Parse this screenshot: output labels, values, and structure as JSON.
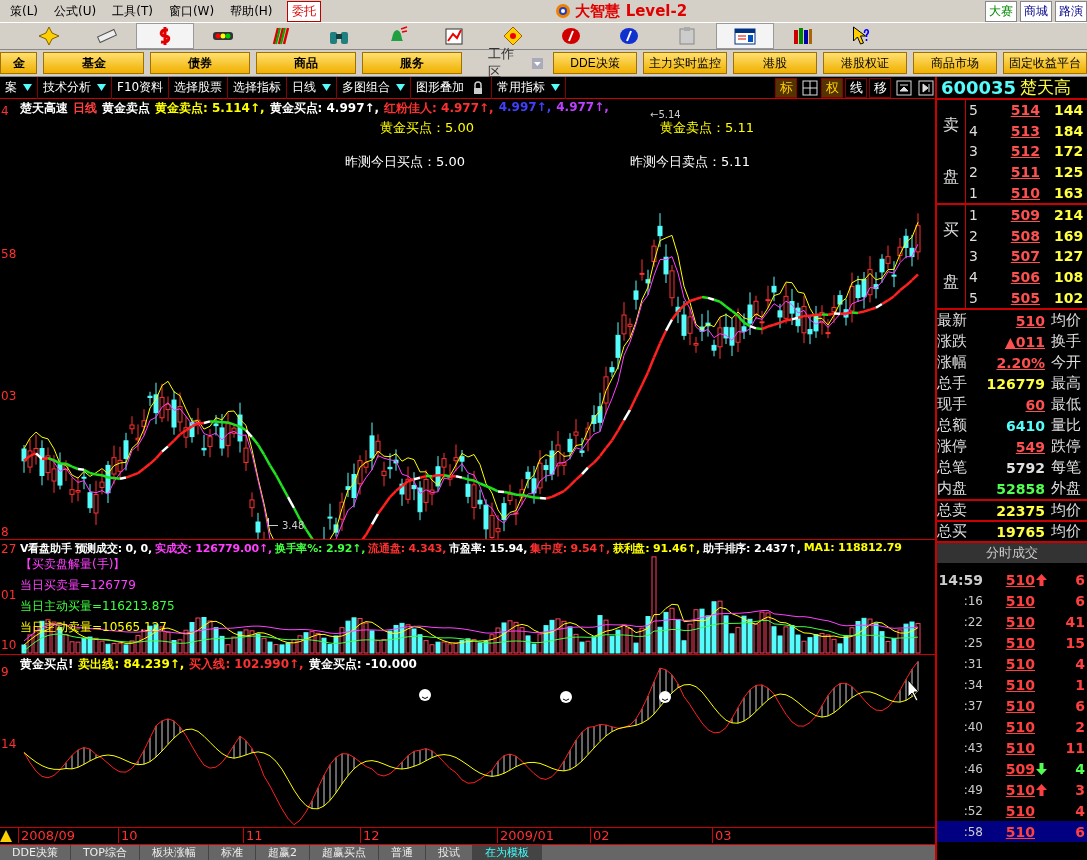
{
  "menu": {
    "items": [
      "策(L)",
      "公式(U)",
      "工具(T)",
      "窗口(W)",
      "帮助(H)"
    ],
    "trade_button": "委托",
    "app_title": "大智慧 Level-2",
    "right_links": [
      "大赛",
      "商城",
      "路演"
    ]
  },
  "toolbar": [
    {
      "kind": "cross",
      "selected": false
    },
    {
      "kind": "ruler",
      "selected": false
    },
    {
      "kind": "dollar",
      "selected": true
    },
    {
      "kind": "lights",
      "selected": false
    },
    {
      "kind": "bars",
      "selected": false
    },
    {
      "kind": "binoculars",
      "selected": false
    },
    {
      "kind": "bell",
      "selected": false
    },
    {
      "kind": "chart",
      "selected": false
    },
    {
      "kind": "diamond",
      "selected": false
    },
    {
      "kind": "redcoin",
      "selected": false
    },
    {
      "kind": "bluecoin",
      "selected": false
    },
    {
      "kind": "clipboard",
      "selected": false
    },
    {
      "kind": "window",
      "selected": true
    },
    {
      "kind": "books",
      "selected": false
    },
    {
      "kind": "help",
      "selected": false
    }
  ],
  "quick_bar": {
    "left_buttons": [
      "金",
      "基金",
      "债券",
      "商品",
      "服务"
    ],
    "workspace_label": "工作区",
    "right_buttons": [
      "DDE决策",
      "主力实时监控",
      "港股",
      "港股权证",
      "商品市场",
      "固定收益平台"
    ]
  },
  "tabs": [
    {
      "label": "案",
      "dropdown": true
    },
    {
      "label": "技术分析",
      "dropdown": true
    },
    {
      "label": "F10资料",
      "dropdown": false
    },
    {
      "label": "选择股票",
      "dropdown": false
    },
    {
      "label": "选择指标",
      "dropdown": false
    },
    {
      "label": "日线",
      "dropdown": true
    },
    {
      "label": "多图组合",
      "dropdown": true
    },
    {
      "label": "图形叠加",
      "dropdown": false,
      "lock": true
    },
    {
      "label": "常用指标",
      "dropdown": true
    }
  ],
  "view_buttons": [
    {
      "kind": "text",
      "label": "标",
      "selected": true
    },
    {
      "kind": "grid"
    },
    {
      "kind": "text",
      "label": "权",
      "selected": true
    },
    {
      "kind": "text",
      "label": "线",
      "selected": false
    },
    {
      "kind": "text",
      "label": "移",
      "selected": false
    },
    {
      "kind": "up"
    },
    {
      "kind": "end"
    }
  ],
  "stock": {
    "code": "600035",
    "name": "楚天高"
  },
  "order_book": {
    "sell_labels": [
      "卖",
      "盘"
    ],
    "buy_labels": [
      "买",
      "盘"
    ],
    "sell": [
      {
        "rank": "5",
        "price": "514",
        "volume": "144"
      },
      {
        "rank": "4",
        "price": "513",
        "volume": "184"
      },
      {
        "rank": "3",
        "price": "512",
        "volume": "172"
      },
      {
        "rank": "2",
        "price": "511",
        "volume": "125"
      },
      {
        "rank": "1",
        "price": "510",
        "volume": "163"
      }
    ],
    "buy": [
      {
        "rank": "1",
        "price": "509",
        "volume": "214"
      },
      {
        "rank": "2",
        "price": "508",
        "volume": "169"
      },
      {
        "rank": "3",
        "price": "507",
        "volume": "127"
      },
      {
        "rank": "4",
        "price": "506",
        "volume": "108"
      },
      {
        "rank": "5",
        "price": "505",
        "volume": "102"
      }
    ]
  },
  "stats": [
    {
      "label": "最新",
      "value": "510",
      "label2": "均价",
      "color": "#ff5050"
    },
    {
      "label": "涨跌",
      "value": "▲011",
      "label2": "换手",
      "color": "#ff5050"
    },
    {
      "label": "涨幅",
      "value": "2.20%",
      "label2": "今开",
      "color": "#ff5050"
    },
    {
      "label": "总手",
      "value": "126779",
      "label2": "最高",
      "color": "#ffff40"
    },
    {
      "label": "现手",
      "value": "60",
      "label2": "最低",
      "color": "#ff5050"
    },
    {
      "label": "总额",
      "value": "6410",
      "label2": "量比",
      "color": "#54fcfc"
    },
    {
      "label": "涨停",
      "value": "549",
      "label2": "跌停",
      "color": "#ff5050"
    },
    {
      "label": "总笔",
      "value": "5792",
      "label2": "每笔",
      "color": "#e0e0e0"
    },
    {
      "label": "内盘",
      "value": "52858",
      "label2": "外盘",
      "color": "#50ff50"
    }
  ],
  "totals": [
    {
      "label": "总卖",
      "value": "22375",
      "label2": "均价"
    },
    {
      "label": "总买",
      "value": "19765",
      "label2": "均价"
    }
  ],
  "trades": {
    "title": "分时成交",
    "rows": [
      {
        "kind": "up",
        "time": "14:59",
        "price": "510",
        "volume": "6",
        "selected": false
      },
      {
        "kind": "plain",
        "time": ":16",
        "price": "510",
        "volume": "6",
        "selected": false
      },
      {
        "kind": "plain",
        "time": ":22",
        "price": "510",
        "volume": "41",
        "selected": false
      },
      {
        "kind": "plain",
        "time": ":25",
        "price": "510",
        "volume": "15",
        "selected": false
      },
      {
        "kind": "plain",
        "time": ":31",
        "price": "510",
        "volume": "4",
        "selected": false
      },
      {
        "kind": "plain",
        "time": ":34",
        "price": "510",
        "volume": "1",
        "selected": false
      },
      {
        "kind": "plain",
        "time": ":37",
        "price": "510",
        "volume": "6",
        "selected": false
      },
      {
        "kind": "plain",
        "time": ":40",
        "price": "510",
        "volume": "2",
        "selected": false
      },
      {
        "kind": "plain",
        "time": ":43",
        "price": "510",
        "volume": "11",
        "selected": false
      },
      {
        "kind": "down",
        "time": ":46",
        "price": "509",
        "volume": "4",
        "selected": false
      },
      {
        "kind": "up",
        "time": ":49",
        "price": "510",
        "volume": "3",
        "selected": false
      },
      {
        "kind": "plain",
        "time": ":52",
        "price": "510",
        "volume": "4",
        "selected": false
      },
      {
        "kind": "plain",
        "time": ":58",
        "price": "510",
        "volume": "6",
        "selected": true
      }
    ]
  },
  "main_chart": {
    "legend": [
      {
        "text": "楚天高速",
        "color": "#ffffff"
      },
      {
        "text": "日线",
        "color": "#ff4040"
      },
      {
        "text": "黄金卖点",
        "color": "#ffffff"
      },
      {
        "text": "黄金卖点: 5.114↑,",
        "color": "#ffff00"
      },
      {
        "text": "黄金买点: 4.997↑,",
        "color": "#ffffff"
      },
      {
        "text": "红粉佳人: 4.977↑,",
        "color": "#ff3030"
      },
      {
        "text": "4.997↑,",
        "color": "#4040ff"
      },
      {
        "text": "4.977↑,",
        "color": "#c040ff"
      }
    ],
    "axis_labels": [
      "4",
      "58",
      "03",
      "8"
    ],
    "annotations": [
      {
        "text": "黄金买点：5.00",
        "color": "#ffff00"
      },
      {
        "text": "黄金卖点：5.11",
        "color": "#ffff00"
      },
      {
        "text": "昨测今日买点：5.00",
        "color": "#ffffff"
      },
      {
        "text": "昨测今日卖点：5.11",
        "color": "#ffffff"
      }
    ],
    "high_mark": "←5.14",
    "low_mark": "3.48"
  },
  "volume_panel": {
    "legend": [
      {
        "text": "V看盘助手",
        "color": "#ffffff"
      },
      {
        "text": "预测成交: 0, 0,",
        "color": "#ffffff"
      },
      {
        "text": "实成交: 126779.00↑,",
        "color": "#ff40ff"
      },
      {
        "text": "换手率%: 2.92↑,",
        "color": "#40ff40"
      },
      {
        "text": "流通盘: 4.343,",
        "color": "#ff3030"
      },
      {
        "text": "市盈率: 15.94,",
        "color": "#ffffff"
      },
      {
        "text": "集中度: 9.54↑,",
        "color": "#ff3030"
      },
      {
        "text": "获利盘: 91.46↑,",
        "color": "#ffff00"
      },
      {
        "text": "助手排序: 2.437↑,",
        "color": "#ffffff"
      },
      {
        "text": "MA1: 118812.79",
        "color": "#ffff00"
      }
    ],
    "notes": [
      {
        "text": "【买卖盘解量(手)】",
        "color": "#ff40ff"
      },
      {
        "text": "当日买卖量=126779",
        "color": "#ff40ff"
      },
      {
        "text": "当日主动买量=116213.875",
        "color": "#40ff40"
      },
      {
        "text": "当日主动卖量=10565.127",
        "color": "#ffff00"
      }
    ],
    "axis_labels": [
      "27",
      "01",
      "10"
    ]
  },
  "signal_panel": {
    "legend": [
      {
        "text": "黄金买点!",
        "color": "#ffffff"
      },
      {
        "text": "卖出线: 84.239↑,",
        "color": "#ffff00"
      },
      {
        "text": "买入线: 102.990↑,",
        "color": "#ff3030"
      },
      {
        "text": "黄金买点: -10.000",
        "color": "#ffffff"
      }
    ],
    "axis_labels": [
      "9",
      "14"
    ]
  },
  "date_axis": [
    "2008/09",
    "10",
    "11",
    "12",
    "2009/01",
    "02",
    "03"
  ],
  "bottom_tabs": [
    {
      "label": "DDE决策",
      "selected": false
    },
    {
      "label": "TOP综合",
      "selected": false
    },
    {
      "label": "板块涨幅",
      "selected": false
    },
    {
      "label": "标准",
      "selected": false
    },
    {
      "label": "超赢2",
      "selected": false
    },
    {
      "label": "超赢买点",
      "selected": false
    },
    {
      "label": "普通",
      "selected": false
    },
    {
      "label": "投试",
      "selected": false
    },
    {
      "label": "在为模板",
      "selected": true
    }
  ]
}
